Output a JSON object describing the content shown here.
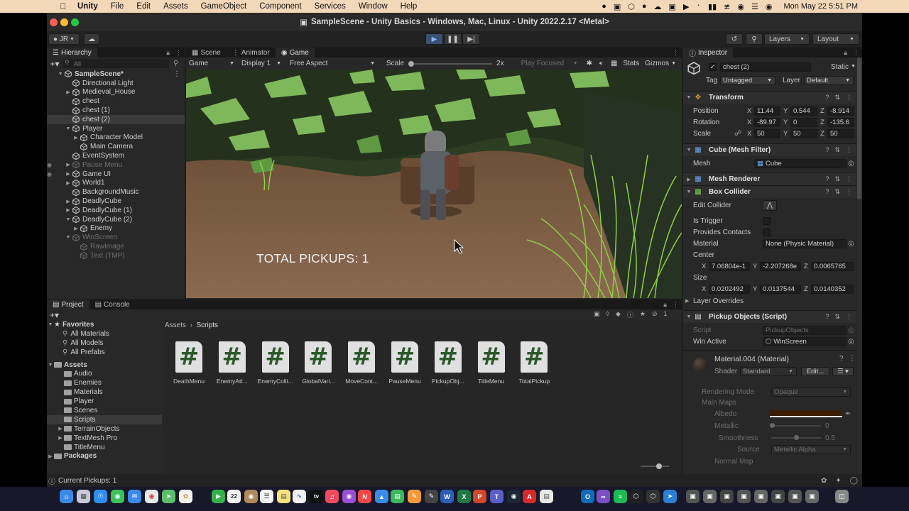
{
  "menubar": {
    "app": "Unity",
    "items": [
      "File",
      "Edit",
      "Assets",
      "GameObject",
      "Component",
      "Services",
      "Window",
      "Help"
    ],
    "clock": "Mon May 22  5:51 PM"
  },
  "window": {
    "title": "SampleScene - Unity Basics - Windows, Mac, Linux - Unity 2022.2.17 <Metal>"
  },
  "toolbar": {
    "account": "JR",
    "layers_label": "Layers",
    "layout_label": "Layout"
  },
  "hierarchy": {
    "tab": "Hierarchy",
    "search_placeholder": "All",
    "scene": "SampleScene*",
    "items": [
      {
        "label": "Directional Light",
        "indent": 1,
        "arrow": "",
        "state": ""
      },
      {
        "label": "Medieval_House",
        "indent": 1,
        "arrow": "▶",
        "state": ""
      },
      {
        "label": "chest",
        "indent": 1,
        "arrow": "",
        "state": ""
      },
      {
        "label": "chest (1)",
        "indent": 1,
        "arrow": "",
        "state": ""
      },
      {
        "label": "chest (2)",
        "indent": 1,
        "arrow": "",
        "state": "sel"
      },
      {
        "label": "Player",
        "indent": 1,
        "arrow": "▼",
        "state": ""
      },
      {
        "label": "Character Model",
        "indent": 2,
        "arrow": "▶",
        "state": ""
      },
      {
        "label": "Main Camera",
        "indent": 2,
        "arrow": "",
        "state": ""
      },
      {
        "label": "EventSystem",
        "indent": 1,
        "arrow": "",
        "state": ""
      },
      {
        "label": "Pause Menu",
        "indent": 1,
        "arrow": "▶",
        "state": "dim"
      },
      {
        "label": "Game UI",
        "indent": 1,
        "arrow": "▶",
        "state": ""
      },
      {
        "label": "World1",
        "indent": 1,
        "arrow": "▶",
        "state": ""
      },
      {
        "label": "BackgroundMusic",
        "indent": 1,
        "arrow": "",
        "state": ""
      },
      {
        "label": "DeadlyCube",
        "indent": 1,
        "arrow": "▶",
        "state": ""
      },
      {
        "label": "DeadlyCube (1)",
        "indent": 1,
        "arrow": "▶",
        "state": ""
      },
      {
        "label": "DeadlyCube (2)",
        "indent": 1,
        "arrow": "▼",
        "state": ""
      },
      {
        "label": "Enemy",
        "indent": 2,
        "arrow": "▶",
        "state": ""
      },
      {
        "label": "WinScreen",
        "indent": 1,
        "arrow": "▼",
        "state": "dim"
      },
      {
        "label": "RawImage",
        "indent": 2,
        "arrow": "",
        "state": "dim"
      },
      {
        "label": "Text (TMP)",
        "indent": 2,
        "arrow": "",
        "state": "dim"
      }
    ]
  },
  "gameview": {
    "tabs": [
      "Scene",
      "Animator",
      "Game"
    ],
    "active_tab": "Game",
    "mode": "Game",
    "display": "Display 1",
    "aspect": "Free Aspect",
    "scale_label": "Scale",
    "scale_value": "2x",
    "play_focused": "Play Focused",
    "stats": "Stats",
    "gizmos": "Gizmos",
    "hud_text": "TOTAL PICKUPS: 1"
  },
  "inspector": {
    "tab": "Inspector",
    "object_name": "chest (2)",
    "static_label": "Static",
    "tag_label": "Tag",
    "tag_value": "Untagged",
    "layer_label": "Layer",
    "layer_value": "Default",
    "transform": {
      "header": "Transform",
      "position_label": "Position",
      "position": {
        "x": "11.44",
        "y": "0.544",
        "z": "-8.914"
      },
      "rotation_label": "Rotation",
      "rotation": {
        "x": "-89.97",
        "y": "0",
        "z": "-135.6"
      },
      "scale_label": "Scale",
      "scale": {
        "x": "50",
        "y": "50",
        "z": "50"
      }
    },
    "mesh_filter": {
      "header": "Cube (Mesh Filter)",
      "mesh_label": "Mesh",
      "mesh_value": "Cube"
    },
    "mesh_renderer": {
      "header": "Mesh Renderer"
    },
    "box_collider": {
      "header": "Box Collider",
      "edit_collider": "Edit Collider",
      "is_trigger": "Is Trigger",
      "provides_contacts": "Provides Contacts",
      "material_label": "Material",
      "material_value": "None (Physic Material)",
      "center_label": "Center",
      "center": {
        "x": "7.06804e-1",
        "y": "-2.207268e",
        "z": "0.0065765"
      },
      "size_label": "Size",
      "size": {
        "x": "0.0202492",
        "y": "0.0137544",
        "z": "0.0140352"
      },
      "layer_overrides": "Layer Overrides"
    },
    "pickup_script": {
      "header": "Pickup Objects (Script)",
      "script_label": "Script",
      "script_value": "PickupObjects",
      "win_active_label": "Win Active",
      "win_active_value": "WinScreen"
    },
    "material": {
      "name": "Material.004 (Material)",
      "shader_label": "Shader",
      "shader_value": "Standard",
      "edit_label": "Edit...",
      "rendering_mode_label": "Rendering Mode",
      "rendering_mode_value": "Opaque",
      "main_maps": "Main Maps",
      "albedo": "Albedo",
      "metallic": "Metallic",
      "metallic_value": "0",
      "smoothness": "Smoothness",
      "smoothness_value": "0.5",
      "source_label": "Source",
      "source_value": "Metallic Alpha",
      "normal_map": "Normal Map"
    }
  },
  "project": {
    "tabs": [
      "Project",
      "Console"
    ],
    "favorites_label": "Favorites",
    "favorites": [
      "All Materials",
      "All Models",
      "All Prefabs"
    ],
    "assets_label": "Assets",
    "folders": [
      {
        "label": "Audio",
        "arrow": "",
        "sel": false
      },
      {
        "label": "Enemies",
        "arrow": "",
        "sel": false
      },
      {
        "label": "Materials",
        "arrow": "",
        "sel": false
      },
      {
        "label": "Player",
        "arrow": "",
        "sel": false
      },
      {
        "label": "Scenes",
        "arrow": "",
        "sel": false
      },
      {
        "label": "Scripts",
        "arrow": "",
        "sel": true
      },
      {
        "label": "TerrainObjects",
        "arrow": "▶",
        "sel": false
      },
      {
        "label": "TextMesh Pro",
        "arrow": "▶",
        "sel": false
      },
      {
        "label": "TitleMenu",
        "arrow": "",
        "sel": false
      }
    ],
    "packages_label": "Packages",
    "breadcrumb_root": "Assets",
    "breadcrumb_leaf": "Scripts",
    "hidden_count": "1",
    "files": [
      "DeathMenu",
      "EnemyAtt...",
      "EnemyColli...",
      "GlobalVari...",
      "MoveCont...",
      "PauseMenu",
      "PickupObj...",
      "TitleMenu",
      "TotalPickup"
    ]
  },
  "statusbar": {
    "message": "Current Pickups: 1"
  },
  "colors": {
    "menubar": "#f2d8b8",
    "editor_bg": "#282828",
    "play_active": "#3a4f72",
    "grass": "#7fb85a",
    "dirt": "#7a5a3f"
  }
}
